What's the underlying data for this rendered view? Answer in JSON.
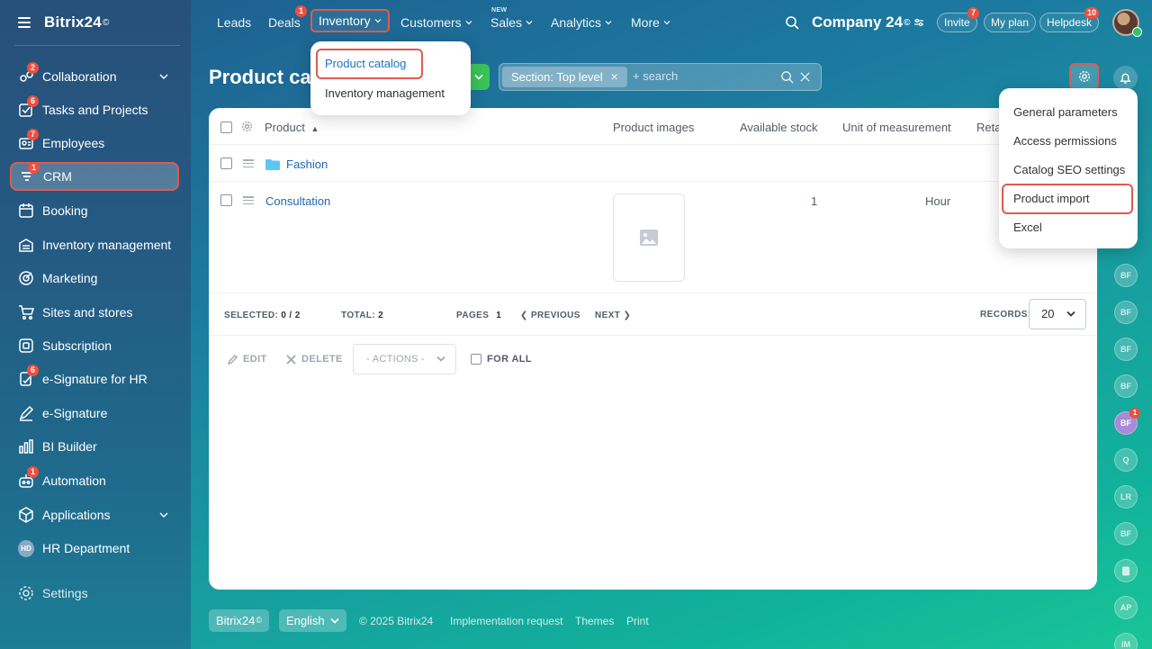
{
  "brand": {
    "name": "Bitrix24",
    "mark": "©"
  },
  "sidebar": {
    "items": [
      {
        "label": "Collaboration",
        "badge": "2"
      },
      {
        "label": "Tasks and Projects",
        "badge": "6"
      },
      {
        "label": "Employees",
        "badge": "7"
      },
      {
        "label": "CRM",
        "badge": "1"
      },
      {
        "label": "Booking",
        "badge": ""
      },
      {
        "label": "Inventory management",
        "badge": ""
      },
      {
        "label": "Marketing",
        "badge": ""
      },
      {
        "label": "Sites and stores",
        "badge": ""
      },
      {
        "label": "Subscription",
        "badge": ""
      },
      {
        "label": "e-Signature for HR",
        "badge": "6"
      },
      {
        "label": "e-Signature",
        "badge": ""
      },
      {
        "label": "BI Builder",
        "badge": ""
      },
      {
        "label": "Automation",
        "badge": "1"
      },
      {
        "label": "Applications",
        "badge": ""
      },
      {
        "label": "HR Department",
        "badge": "",
        "avatar": "HD"
      },
      {
        "label": "Settings",
        "badge": ""
      }
    ]
  },
  "topnav": {
    "leads": "Leads",
    "deals": "Deals",
    "deals_badge": "1",
    "inventory": "Inventory",
    "customers": "Customers",
    "sales": "Sales",
    "sales_tag": "NEW",
    "analytics": "Analytics",
    "more": "More",
    "company": "Company 24",
    "invite": "Invite",
    "invite_badge": "7",
    "my_plan": "My plan",
    "helpdesk": "Helpdesk",
    "helpdesk_badge": "10"
  },
  "inventory_menu": {
    "product_catalog": "Product catalog",
    "inventory_management": "Inventory management"
  },
  "page": {
    "title": "Product cat",
    "filter_chip": "Section: Top level",
    "filter_placeholder": "+ search"
  },
  "settings_menu": {
    "general": "General parameters",
    "access": "Access permissions",
    "seo": "Catalog SEO settings",
    "import": "Product import",
    "excel": "Excel"
  },
  "right_avatars": [
    "BF",
    "BF",
    "BF",
    "BF",
    "BF",
    "Q",
    "LR",
    "BF",
    "",
    "AP",
    "IM"
  ],
  "right_avatar_badge": "1",
  "table": {
    "headers": {
      "product": "Product",
      "images": "Product images",
      "stock": "Available stock",
      "unit": "Unit of measurement",
      "retail": "Reta"
    },
    "rows": [
      {
        "name": "Fashion",
        "type": "folder"
      },
      {
        "name": "Consultation",
        "stock": "1",
        "unit": "Hour"
      }
    ]
  },
  "pager": {
    "selected_label": "SELECTED:",
    "selected": "0 / 2",
    "total_label": "TOTAL:",
    "total": "2",
    "pages_label": "PAGES",
    "page": "1",
    "previous": "PREVIOUS",
    "next": "NEXT",
    "records_label": "RECORDS:",
    "records": "20"
  },
  "actions": {
    "edit": "EDIT",
    "delete": "DELETE",
    "actions_select": "- ACTIONS -",
    "for_all": "FOR ALL"
  },
  "footer": {
    "brand": "Bitrix24",
    "language": "English",
    "copyright": "© 2025 Bitrix24",
    "implementation": "Implementation request",
    "themes": "Themes",
    "print": "Print"
  },
  "colors": {
    "highlight": "#e05a4f",
    "link": "#2067b0",
    "badge": "#ef4e3e",
    "accent_green": "#3bc257"
  }
}
